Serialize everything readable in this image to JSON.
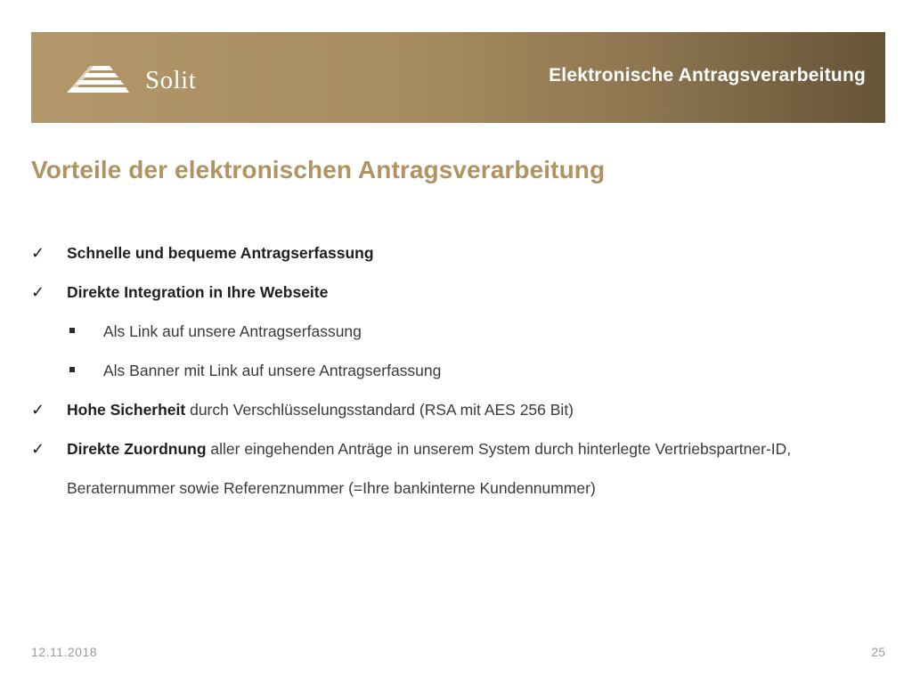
{
  "header": {
    "logo_text": "Solit",
    "title": "Elektronische Antragsverarbeitung"
  },
  "slide": {
    "title": "Vorteile der elektronischen Antragsverarbeitung",
    "items": [
      {
        "strong": "Schnelle und bequeme Antragserfassung",
        "rest": ""
      },
      {
        "strong": "Direkte Integration in Ihre Webseite",
        "rest": ""
      },
      {
        "strong": "Hohe Sicherheit",
        "rest": " durch Verschlüsselungsstandard (RSA mit AES 256 Bit)"
      },
      {
        "strong": "Direkte Zuordnung",
        "rest": " aller eingehenden Anträge in unserem System durch hinterlegte Vertriebspartner-ID, Beraternummer sowie Referenznummer (=Ihre bankinterne Kundennummer)"
      }
    ],
    "subitems": [
      "Als Link auf unsere Antragserfassung",
      "Als Banner mit Link auf unsere Antragserfassung"
    ]
  },
  "footer": {
    "date": "12.11.2018",
    "page": "25"
  },
  "colors": {
    "banner_start": "#b3976a",
    "banner_end": "#665437",
    "title_gold": "#b0935f"
  }
}
